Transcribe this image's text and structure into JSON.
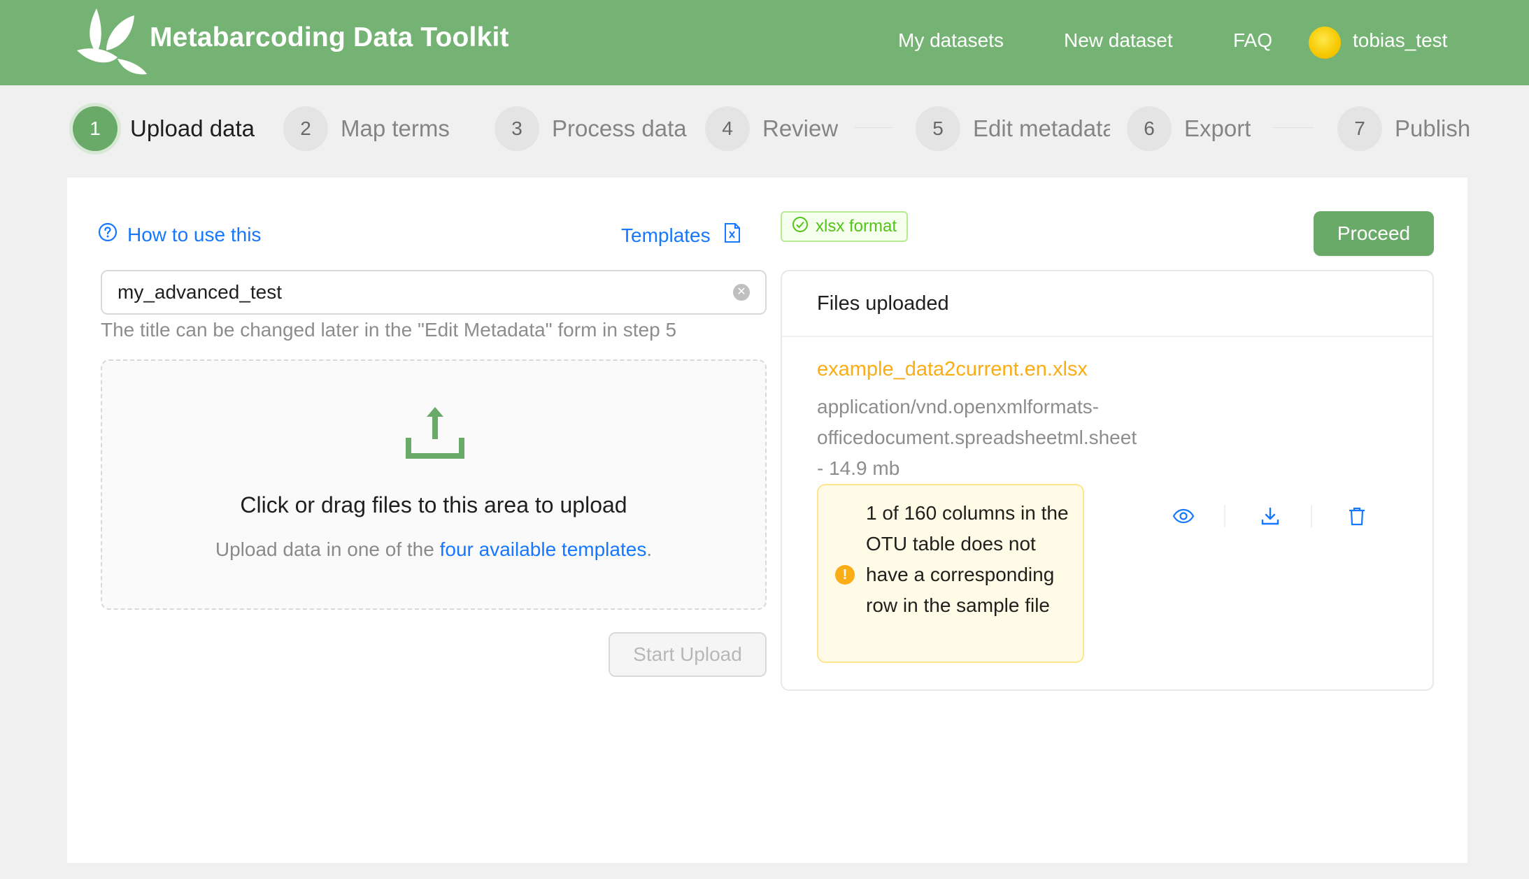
{
  "header": {
    "app_title": "Metabarcoding Data Toolkit",
    "nav": {
      "my_datasets": "My datasets",
      "new_dataset": "New dataset",
      "faq": "FAQ",
      "username": "tobias_test"
    }
  },
  "steps": [
    {
      "number": "1",
      "label": "Upload data",
      "active": true
    },
    {
      "number": "2",
      "label": "Map terms"
    },
    {
      "number": "3",
      "label": "Process data"
    },
    {
      "number": "4",
      "label": "Review"
    },
    {
      "number": "5",
      "label": "Edit metadata"
    },
    {
      "number": "6",
      "label": "Export"
    },
    {
      "number": "7",
      "label": "Publish"
    }
  ],
  "upload": {
    "how_to_label": "How to use this",
    "templates_label": "Templates",
    "title_value": "my_advanced_test",
    "title_help": "The title can be changed later in the \"Edit Metadata\" form in step 5",
    "dropzone_text": "Click or drag files to this area to upload",
    "dropzone_hint_prefix": "Upload data in one of the",
    "dropzone_hint_link": "four available templates",
    "dropzone_hint_suffix": ".",
    "start_upload_label": "Start Upload"
  },
  "format_tag": "xlsx format",
  "proceed_label": "Proceed",
  "files": {
    "heading": "Files uploaded",
    "items": [
      {
        "name": "example_data2current.en.xlsx",
        "mime_line1": "application/vnd.openxmlformats-",
        "mime_line2": "officedocument.spreadsheetml.sheet",
        "size": "- 14.9 mb",
        "warning": "1 of 160 columns in the OTU table does not have a corresponding row in the sample file"
      }
    ]
  },
  "colors": {
    "brand_green": "#75b374",
    "primary_green": "#6aaa69",
    "link_blue": "#1677ff",
    "warning_orange": "#faad14",
    "success_green": "#52c41a"
  },
  "icons": {
    "logo": "leaf-logo-icon",
    "user": "user-avatar-icon",
    "help": "question-circle-icon",
    "templates": "excel-file-icon",
    "upload": "upload-icon",
    "clear": "close-circle-icon",
    "format": "check-circle-icon",
    "warning": "exclamation-circle-icon",
    "view": "eye-icon",
    "download": "download-icon",
    "delete": "trash-icon"
  }
}
